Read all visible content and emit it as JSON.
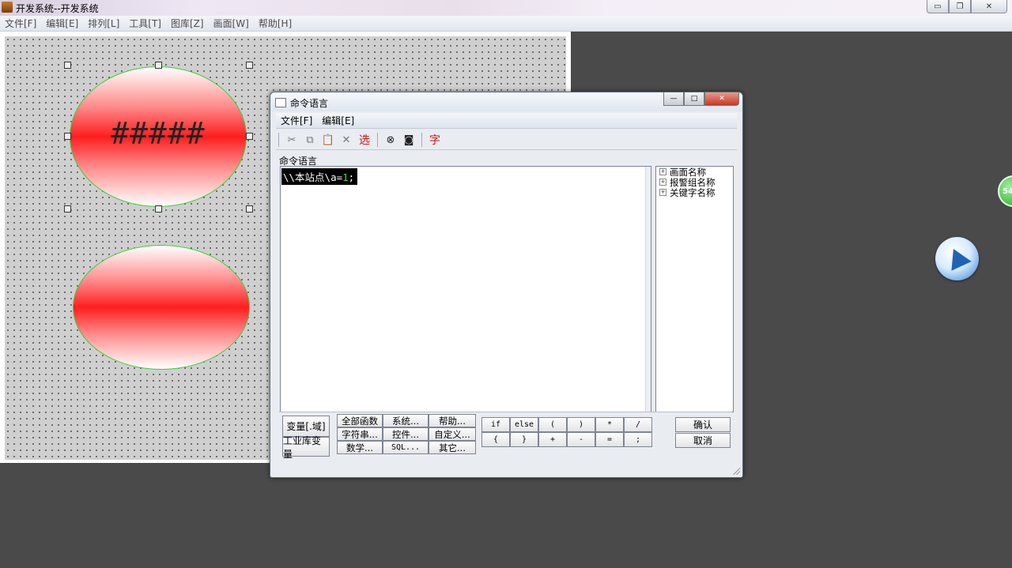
{
  "window": {
    "title": "开发系统--开发系统",
    "buttons": [
      "minimize",
      "restore",
      "close"
    ]
  },
  "menubar": [
    "文件[F]",
    "编辑[E]",
    "排列[L]",
    "工具[T]",
    "图库[Z]",
    "画面[W]",
    "帮助[H]"
  ],
  "canvas": {
    "ellipse1_text": "#####",
    "ellipse_fill_center": "#ff1e1e",
    "ellipse_border": "#3bd13b"
  },
  "dialog": {
    "title": "命令语言",
    "menu": [
      "文件[F]",
      "编辑[E]"
    ],
    "toolbar": {
      "cut_icon": "scissors-icon",
      "copy_icon": "copy-icon",
      "paste_icon": "paste-icon",
      "delete_icon": "x-icon",
      "select_label": "选",
      "find_icon": "binoculars-icon",
      "replace_icon": "camera-icon",
      "font_label": "字"
    },
    "editor_label": "命令语言",
    "code": {
      "prefix": "\\\\本站点\\a=",
      "number": "1",
      "suffix": ";"
    },
    "tree": [
      "画面名称",
      "报警组名称",
      "关键字名称"
    ],
    "tree_toggle": "+",
    "left_buttons": [
      "变量[.域]",
      "工业库变量"
    ],
    "func_buttons": [
      [
        "全部函数",
        "系统...",
        "帮助..."
      ],
      [
        "字符串...",
        "控件...",
        "自定义..."
      ],
      [
        "数学...",
        "SQL...",
        "其它..."
      ]
    ],
    "op_buttons": [
      [
        "if",
        "else",
        "(",
        ")",
        "*",
        "/"
      ],
      [
        "{",
        "}",
        "+",
        "-",
        "=",
        ";"
      ]
    ],
    "confirm": "确认",
    "cancel": "取消"
  },
  "desktop": {
    "badge_text": "54"
  }
}
